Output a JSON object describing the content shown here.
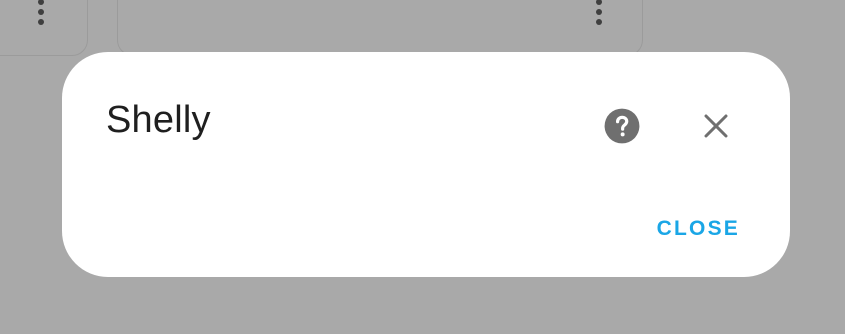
{
  "dialog": {
    "title": "Shelly",
    "close_label": "CLOSE",
    "help_icon": "help-circle-icon",
    "close_icon": "close-icon"
  },
  "colors": {
    "scrim": "#a9a9a9",
    "dialog_bg": "#ffffff",
    "accent": "#1aa6e6",
    "icon": "#6f6f6f",
    "title_text": "#1f1f1f"
  }
}
